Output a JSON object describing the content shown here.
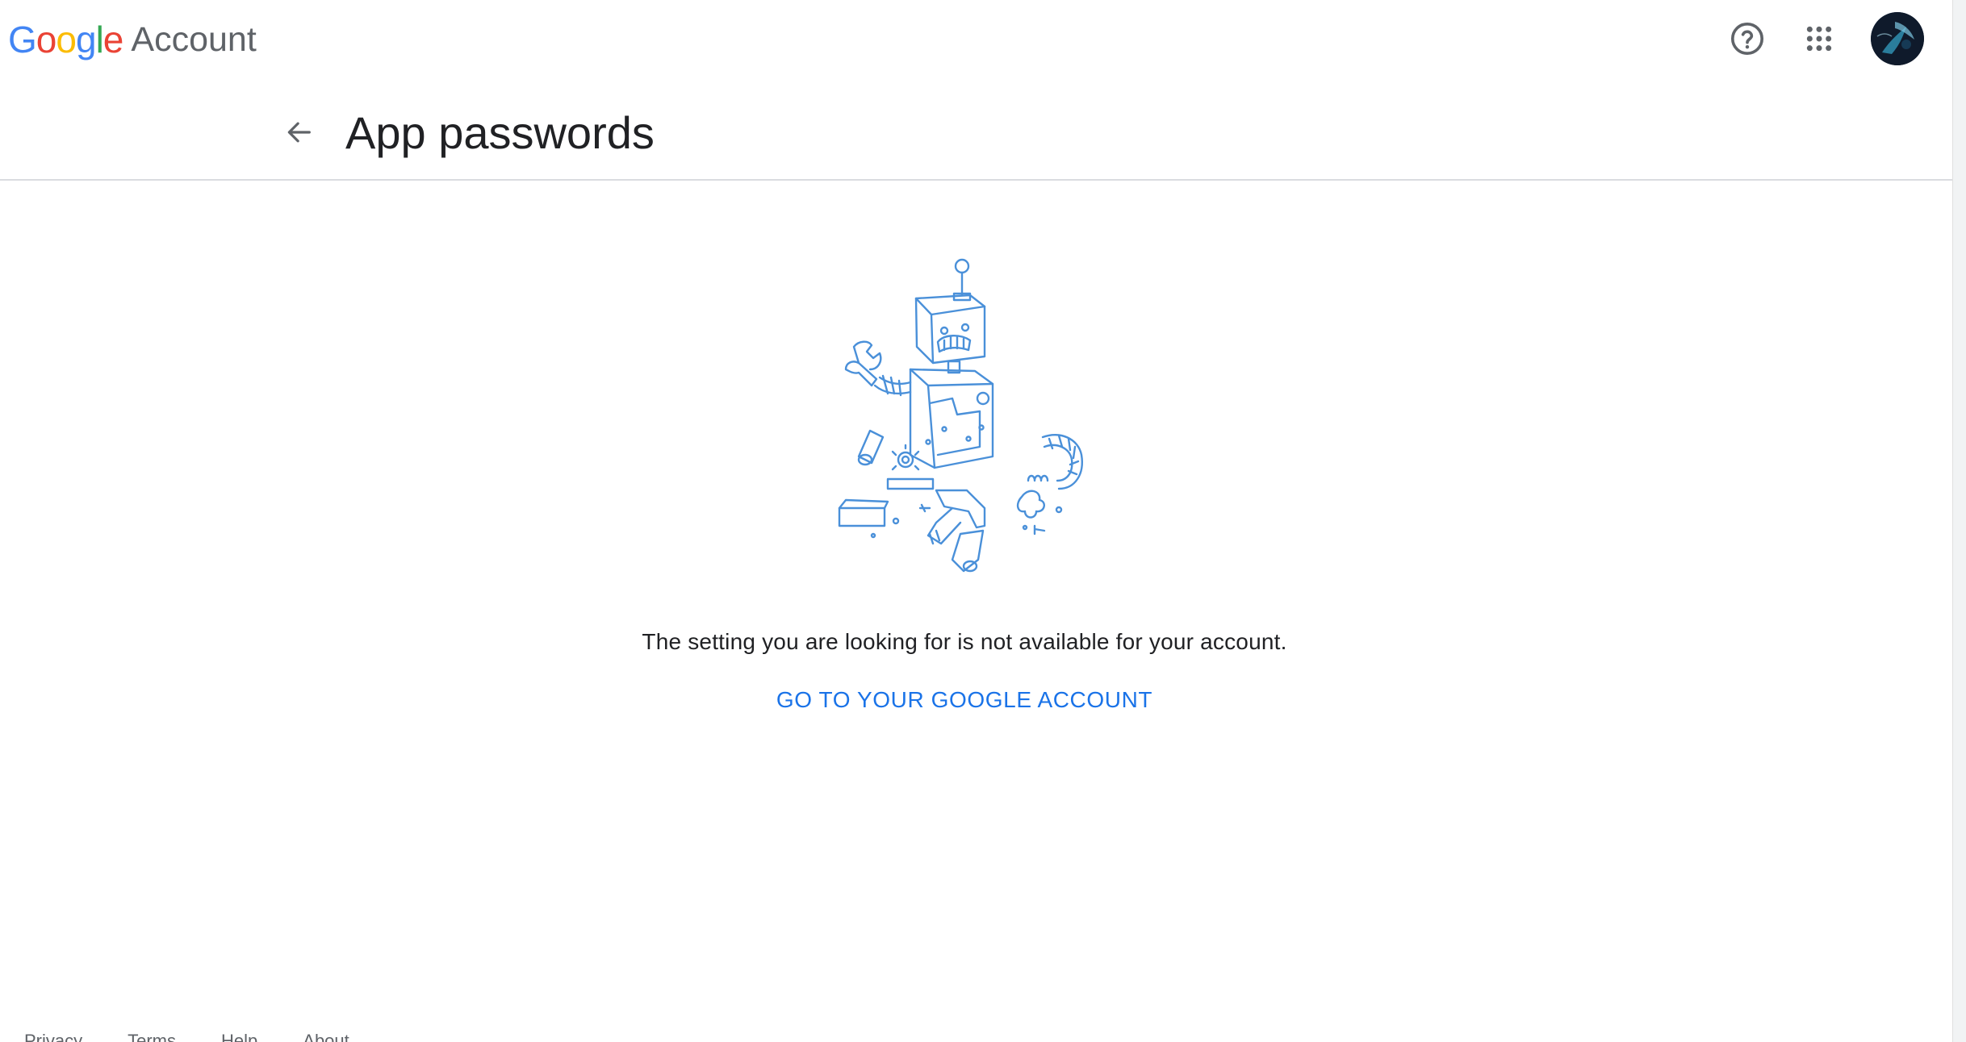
{
  "header": {
    "logo_google_letters": [
      {
        "char": "G",
        "color": "#4285F4"
      },
      {
        "char": "o",
        "color": "#EA4335"
      },
      {
        "char": "o",
        "color": "#FBBC05"
      },
      {
        "char": "g",
        "color": "#4285F4"
      },
      {
        "char": "l",
        "color": "#34A853"
      },
      {
        "char": "e",
        "color": "#EA4335"
      }
    ],
    "logo_product": "Account",
    "help_icon": "help-circle-icon",
    "apps_icon": "apps-grid-icon",
    "avatar_icon": "account-avatar"
  },
  "page": {
    "back_icon": "arrow-back-icon",
    "title": "App passwords"
  },
  "main": {
    "illustration": "broken-robot-illustration",
    "message": "The setting you are looking for is not available for your account.",
    "cta_label": "GO TO YOUR GOOGLE ACCOUNT"
  },
  "footer": {
    "links": [
      "Privacy",
      "Terms",
      "Help",
      "About"
    ]
  },
  "colors": {
    "accent": "#1a73e8",
    "illustration_stroke": "#4a90d9",
    "divider": "#dadce0",
    "icon_gray": "#5f6368"
  }
}
